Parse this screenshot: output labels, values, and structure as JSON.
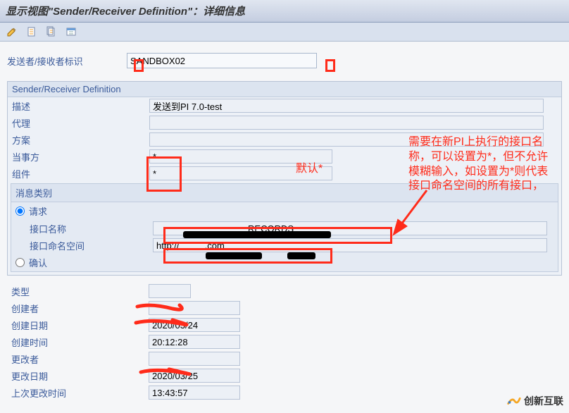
{
  "title": "显示视图\"Sender/Receiver Definition\"：详细信息",
  "identifier_label": "发送者/接收者标识",
  "identifier_value": "SANDBOX02",
  "group_title": "Sender/Receiver Definition",
  "fields": {
    "description_label": "描述",
    "description_value": "发送到PI 7.0-test",
    "agent_label": "代理",
    "agent_value": "",
    "scheme_label": "方案",
    "scheme_value": "",
    "party_label": "当事方",
    "party_value": "*",
    "component_label": "组件",
    "component_value": "*"
  },
  "msg_group_title": "消息类别",
  "radio_request": "请求",
  "radio_confirm": "确认",
  "interface_name_label": "接口名称",
  "interface_name_value": "                                    RECORDS",
  "interface_ns_label": "接口命名空间",
  "interface_ns_value": "http://          .com",
  "meta": {
    "type_label": "类型",
    "type_value": "",
    "creator_label": "创建者",
    "creator_value": "",
    "create_date_label": "创建日期",
    "create_date_value": "2020/03/24",
    "create_time_label": "创建时间",
    "create_time_value": "20:12:28",
    "changer_label": "更改者",
    "changer_value": "",
    "change_date_label": "更改日期",
    "change_date_value": "2020/03/25",
    "last_change_time_label": "上次更改时间",
    "last_change_time_value": "13:43:57"
  },
  "annotations": {
    "default_star": "默认*",
    "side_note": "需要在新PI上执行的接口名称，可以设置为*，但不允许模糊输入，如设置为*则代表接口命名空间的所有接口，"
  },
  "watermark_text": "创新互联"
}
